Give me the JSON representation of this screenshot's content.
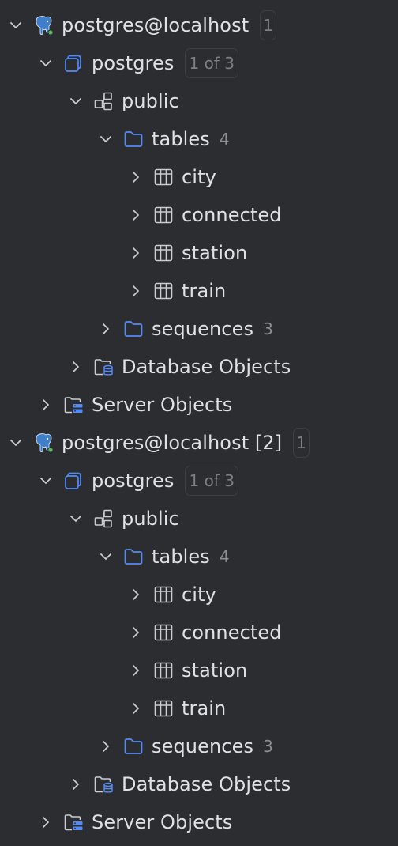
{
  "tree": [
    {
      "connection": {
        "label": "postgres@localhost",
        "badge": "1"
      },
      "database": {
        "label": "postgres",
        "badge": "1 of 3"
      },
      "schema": {
        "label": "public"
      },
      "tables": {
        "label": "tables",
        "count": "4"
      },
      "table_items": [
        "city",
        "connected",
        "station",
        "train"
      ],
      "sequences": {
        "label": "sequences",
        "count": "3"
      },
      "db_objects": {
        "label": "Database Objects"
      },
      "server_objects": {
        "label": "Server Objects"
      }
    },
    {
      "connection": {
        "label": "postgres@localhost [2]",
        "badge": "1"
      },
      "database": {
        "label": "postgres",
        "badge": "1 of 3"
      },
      "schema": {
        "label": "public"
      },
      "tables": {
        "label": "tables",
        "count": "4"
      },
      "table_items": [
        "city",
        "connected",
        "station",
        "train"
      ],
      "sequences": {
        "label": "sequences",
        "count": "3"
      },
      "db_objects": {
        "label": "Database Objects"
      },
      "server_objects": {
        "label": "Server Objects"
      }
    }
  ],
  "icons": {
    "connection": "postgresql-elephant-icon",
    "database": "database-icon",
    "schema": "schema-icon",
    "folder": "folder-icon",
    "table": "table-icon",
    "db_objects": "database-objects-icon",
    "server_objects": "server-objects-icon"
  },
  "colors": {
    "background": "#2b2d30",
    "text": "#dfe1e5",
    "muted": "#8b8e94",
    "accent_blue": "#548af7",
    "status_green": "#5fb865"
  }
}
